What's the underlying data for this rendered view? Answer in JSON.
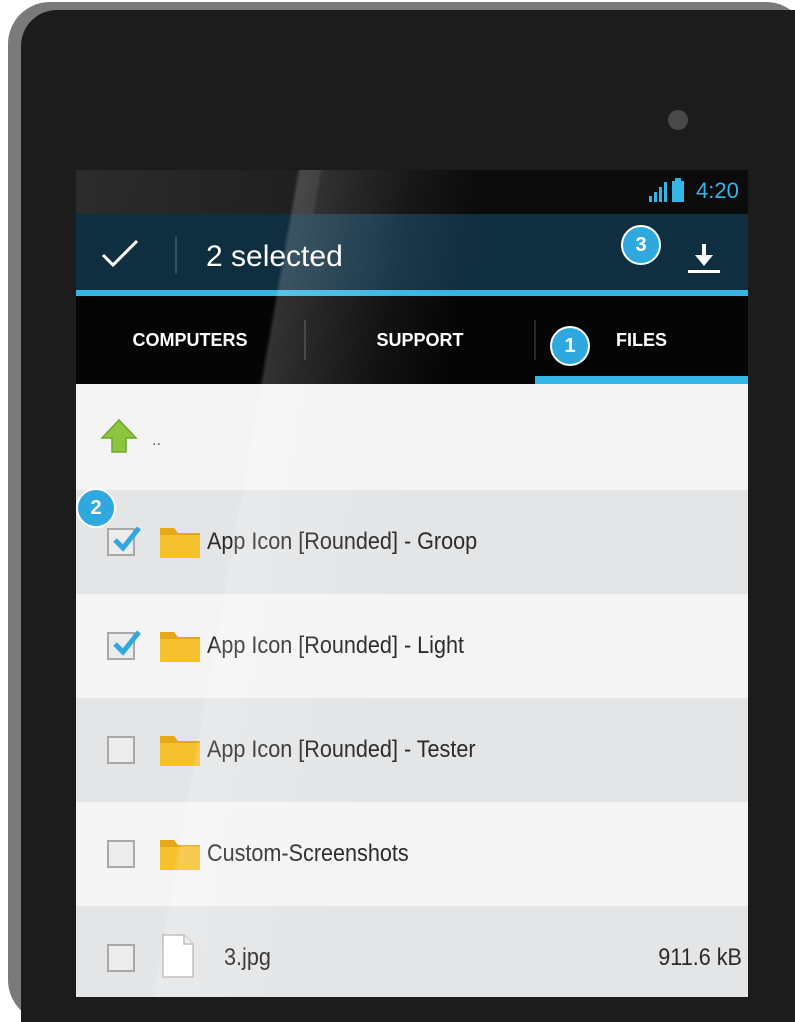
{
  "status_bar": {
    "time": "4:20",
    "icons": [
      "signal-icon",
      "battery-icon"
    ]
  },
  "action_bar": {
    "selected_label": "2 selected",
    "icons": [
      "checkmark-done-icon",
      "download-icon"
    ]
  },
  "tabs": [
    {
      "label": "COMPUTERS",
      "active": false
    },
    {
      "label": "SUPPORT",
      "active": false
    },
    {
      "label": "FILES",
      "active": true
    }
  ],
  "up_row": {
    "label": "..",
    "icon": "folder-up-arrow-icon"
  },
  "items": [
    {
      "name": "App Icon [Rounded] - Groop",
      "type": "folder",
      "checked": true,
      "size": ""
    },
    {
      "name": "App Icon [Rounded] - Light",
      "type": "folder",
      "checked": true,
      "size": ""
    },
    {
      "name": "App Icon [Rounded] - Tester",
      "type": "folder",
      "checked": false,
      "size": ""
    },
    {
      "name": "Custom-Screenshots",
      "type": "folder",
      "checked": false,
      "size": ""
    },
    {
      "name": "3.jpg",
      "type": "file",
      "checked": false,
      "size": "911.6 kB"
    }
  ],
  "callouts": [
    "1",
    "2",
    "3"
  ],
  "colors": {
    "accent": "#33b5e5",
    "action_bar": "#0f2e40",
    "tab_bar": "#050505",
    "callout": "#2fa8e0",
    "folder": "#f5c02e",
    "up_arrow": "#8cc63f"
  }
}
